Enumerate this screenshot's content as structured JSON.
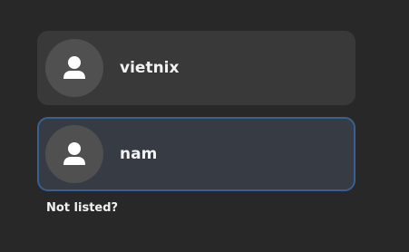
{
  "users": [
    {
      "name": "vietnix",
      "avatar_icon": "user-avatar-icon",
      "selected": false
    },
    {
      "name": "nam",
      "avatar_icon": "user-avatar-icon",
      "selected": true
    }
  ],
  "not_listed_label": "Not listed?",
  "colors": {
    "background": "#282828",
    "row_background": "#393939",
    "selected_row_background": "#373b44",
    "selected_border": "#3a5f92",
    "avatar_background": "#505050",
    "text": "#f2f2f2"
  }
}
